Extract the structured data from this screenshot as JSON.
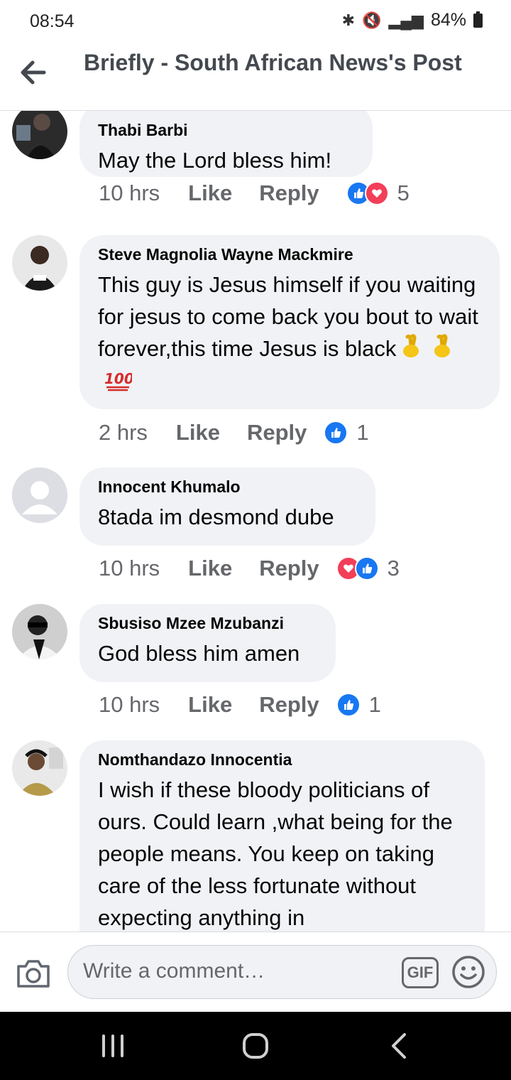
{
  "status_bar": {
    "time": "08:54",
    "battery": "84%"
  },
  "header": {
    "title": "Briefly - South African News's Post"
  },
  "comments": [
    {
      "name": "Thabi Barbi",
      "text": "May the Lord bless him!",
      "time": "10 hrs",
      "like": "Like",
      "reply": "Reply",
      "reactions": [
        "like",
        "love"
      ],
      "count": "5"
    },
    {
      "name": "Steve Magnolia Wayne Mackmire",
      "text": "This guy is Jesus himself if you waiting for jesus to come back you bout to wait forever,this  time Jesus is black",
      "emojis": [
        "crossed-fingers",
        "crossed-fingers",
        "hundred-points"
      ],
      "time": "2 hrs",
      "like": "Like",
      "reply": "Reply",
      "reactions": [
        "like"
      ],
      "count": "1"
    },
    {
      "name": "Innocent Khumalo",
      "text": "8tada im desmond dube",
      "time": "10 hrs",
      "like": "Like",
      "reply": "Reply",
      "reactions": [
        "love",
        "like"
      ],
      "count": "3"
    },
    {
      "name": "Sbusiso Mzee Mzubanzi",
      "text": "God bless him amen",
      "time": "10 hrs",
      "like": "Like",
      "reply": "Reply",
      "reactions": [
        "like"
      ],
      "count": "1"
    },
    {
      "name": "Nomthandazo Innocentia",
      "text": "I wish if these bloody politicians of ours. Could learn ,what being for the people means. You keep on taking care of the less fortunate without expecting anything in"
    }
  ],
  "composer": {
    "placeholder": "Write a comment…",
    "gif": "GIF"
  },
  "icons": {
    "like_color": "#1877f2",
    "love_color": "#f33e58",
    "bubble_color": "#f0f2f5"
  }
}
